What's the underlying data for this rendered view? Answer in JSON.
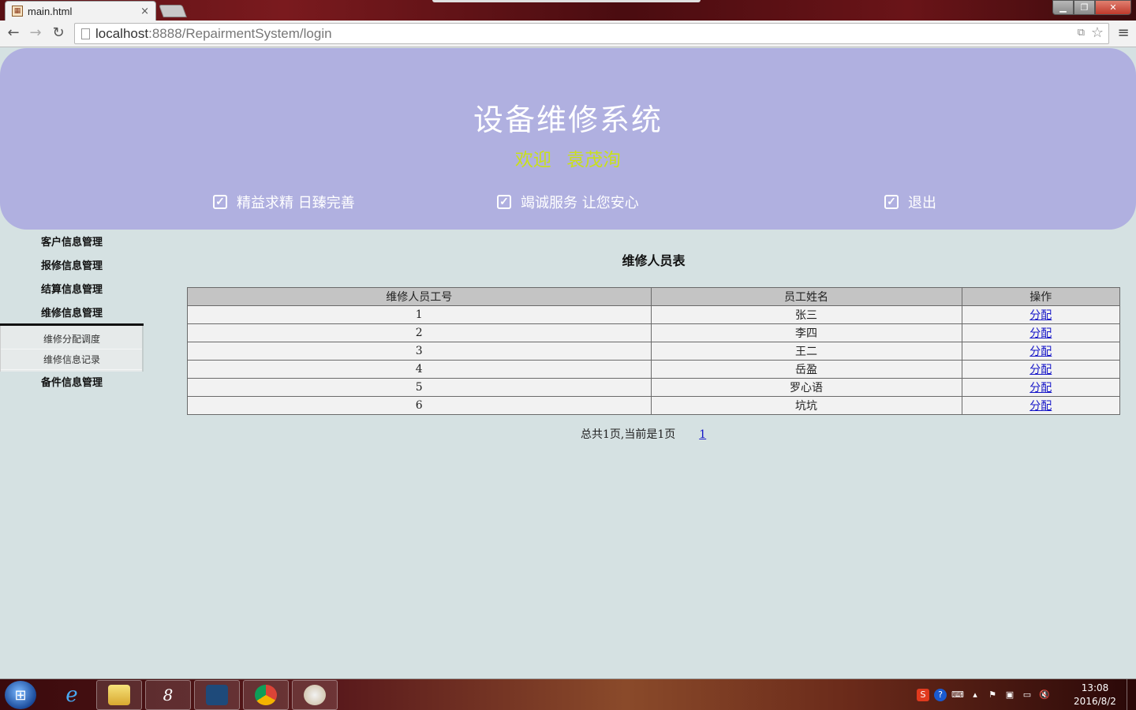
{
  "browser": {
    "tab_title": "main.html",
    "tab_close": "×",
    "url_host": "localhost",
    "url_rest": ":8888/RepairmentSystem/login"
  },
  "header": {
    "system_title": "设备维修系统",
    "welcome_label": "欢迎",
    "user_name": "袁茂洵",
    "slogan_1": "精益求精  日臻完善",
    "slogan_2": "竭诚服务  让您安心",
    "logout": "退出"
  },
  "sidebar": {
    "menus": [
      {
        "label": "客户信息管理"
      },
      {
        "label": "报修信息管理"
      },
      {
        "label": "结算信息管理"
      },
      {
        "label": "维修信息管理"
      }
    ],
    "submenu": [
      {
        "label": "维修分配调度"
      },
      {
        "label": "维修信息记录"
      }
    ],
    "last_menu": "备件信息管理"
  },
  "main": {
    "table_title": "维修人员表",
    "columns": [
      "维修人员工号",
      "员工姓名",
      "操作"
    ],
    "rows": [
      {
        "id": "1",
        "name": "张三",
        "action": "分配"
      },
      {
        "id": "2",
        "name": "李四",
        "action": "分配"
      },
      {
        "id": "3",
        "name": "王二",
        "action": "分配"
      },
      {
        "id": "4",
        "name": "岳盈",
        "action": "分配"
      },
      {
        "id": "5",
        "name": "罗心语",
        "action": "分配"
      },
      {
        "id": "6",
        "name": "坑坑",
        "action": "分配"
      }
    ],
    "pagination_text": "总共1页,当前是1页",
    "page_link": "1"
  },
  "taskbar": {
    "clock_time": "13:08",
    "clock_date": "2016/8/2"
  }
}
